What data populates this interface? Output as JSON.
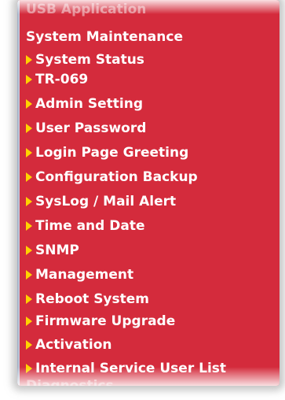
{
  "menu": {
    "prev_section": "USB Application",
    "section_title": "System Maintenance",
    "items": [
      {
        "label": "System Status"
      },
      {
        "label": "TR-069"
      },
      {
        "label": "Admin Setting"
      },
      {
        "label": "User Password"
      },
      {
        "label": "Login Page Greeting"
      },
      {
        "label": "Configuration Backup"
      },
      {
        "label": "SysLog / Mail Alert"
      },
      {
        "label": "Time and Date"
      },
      {
        "label": "SNMP"
      },
      {
        "label": "Management"
      },
      {
        "label": "Reboot System"
      },
      {
        "label": "Firmware Upgrade"
      },
      {
        "label": "Activation"
      },
      {
        "label": "Internal Service User List"
      }
    ],
    "next_section": "Diagnostics"
  },
  "colors": {
    "panel_background": "#d42b3c",
    "arrow": "#ffd200",
    "text": "#ffffff"
  },
  "icons": {
    "item_bullet": "triangle-right-icon"
  }
}
